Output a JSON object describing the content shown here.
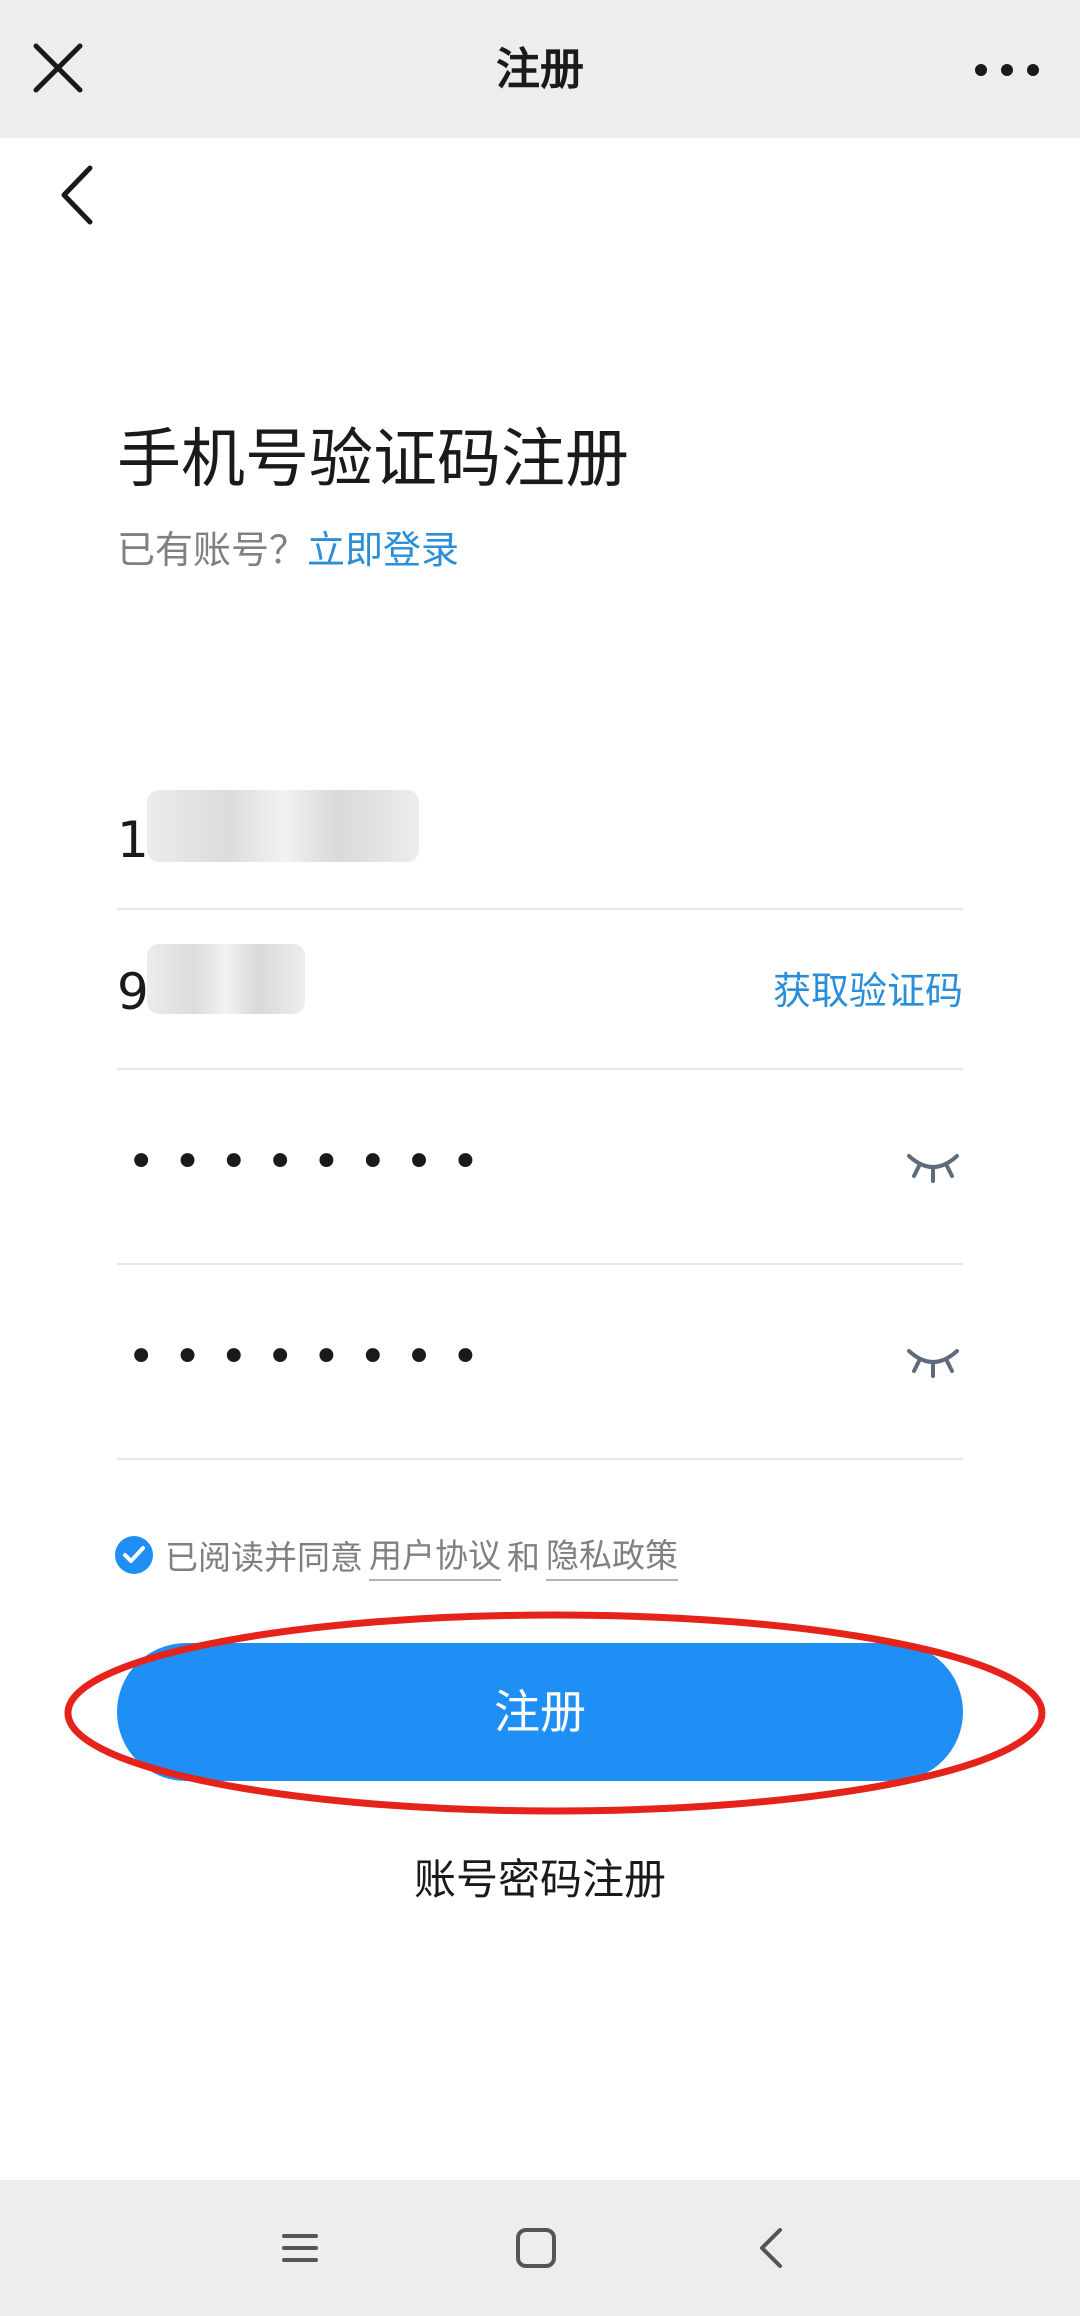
{
  "topbar": {
    "title": "注册",
    "close_icon": "close-icon",
    "more_icon": "more-horizontal-icon"
  },
  "header": {
    "heading": "手机号验证码注册",
    "has_account": "已有账号？",
    "login_link": "立即登录"
  },
  "form": {
    "phone_value": "1",
    "code_value": "9",
    "get_code_label": "获取验证码",
    "password_dots": "••••••••",
    "confirm_dots": "••••••••"
  },
  "agreement": {
    "checked": true,
    "prefix": "已阅读并同意",
    "user_agreement": "用户协议",
    "and": "和",
    "privacy_policy": "隐私政策"
  },
  "register_label": "注册",
  "alt_register_label": "账号密码注册",
  "colors": {
    "accent": "#1f8ff5",
    "link": "#2a8fd8",
    "annotation": "#e5231b"
  }
}
